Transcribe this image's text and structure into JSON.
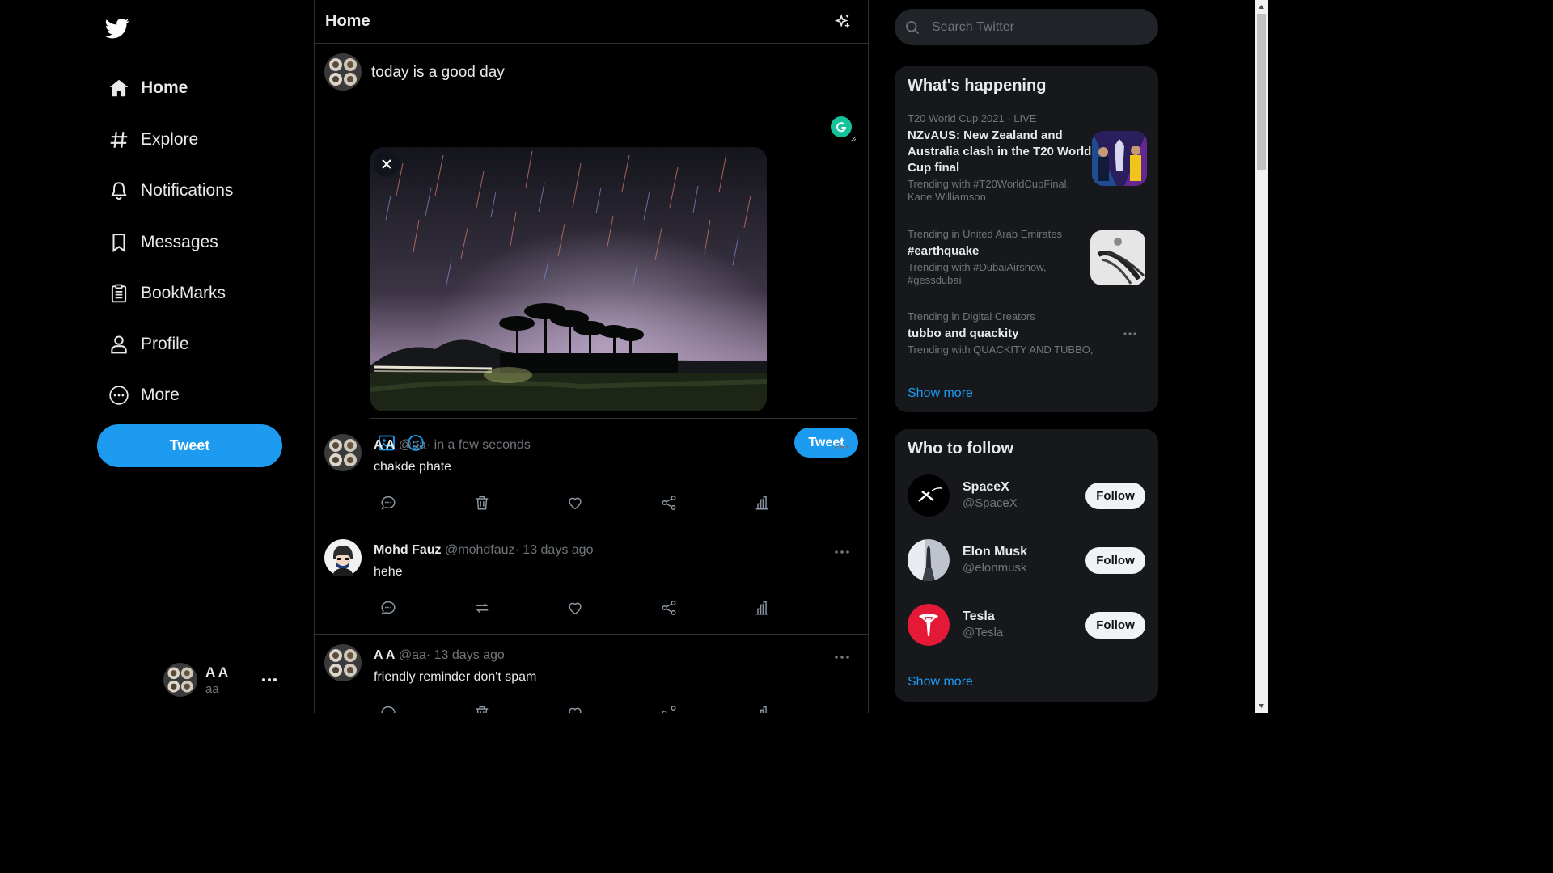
{
  "sidebar": {
    "nav": [
      {
        "label": "Home",
        "icon": "home-icon"
      },
      {
        "label": "Explore",
        "icon": "hashtag-icon"
      },
      {
        "label": "Notifications",
        "icon": "bell-icon"
      },
      {
        "label": "Messages",
        "icon": "bookmark-icon"
      },
      {
        "label": "BookMarks",
        "icon": "clipboard-icon"
      },
      {
        "label": "Profile",
        "icon": "user-icon"
      },
      {
        "label": "More",
        "icon": "more-circle-icon"
      }
    ],
    "tweet_button": "Tweet",
    "user": {
      "name": "A A",
      "handle": "aa"
    }
  },
  "main": {
    "title": "Home",
    "composer": {
      "text": "today is a good day",
      "tweet_button": "Tweet"
    },
    "tweets": [
      {
        "name": "A A",
        "handle": "@aa",
        "time": "· in a few seconds",
        "text": "chakde phate",
        "second_action_icon": "trash-icon"
      },
      {
        "name": "Mohd Fauz",
        "handle": "@mohdfauz",
        "time": "· 13 days ago",
        "text": "hehe",
        "second_action_icon": "retweet-icon"
      },
      {
        "name": "A A",
        "handle": "@aa",
        "time": "· 13 days ago",
        "text": "friendly reminder don't spam",
        "second_action_icon": "trash-icon"
      }
    ]
  },
  "right": {
    "search_placeholder": "Search Twitter",
    "happening": {
      "title": "What's happening",
      "trends": [
        {
          "meta": "T20 World Cup 2021 · LIVE",
          "title": "NZvAUS: New Zealand and Australia clash in the T20 World Cup final",
          "sub": "Trending with #T20WorldCupFinal, Kane Williamson"
        },
        {
          "meta": "Trending in United Arab Emirates",
          "title": "#earthquake",
          "sub": "Trending with #DubaiAirshow, #gessdubai"
        },
        {
          "meta": "Trending in Digital Creators",
          "title": "tubbo and quackity",
          "sub": "Trending with QUACKITY AND TUBBO,"
        }
      ],
      "show_more": "Show more"
    },
    "who_to_follow": {
      "title": "Who to follow",
      "accounts": [
        {
          "name": "SpaceX",
          "handle": "@SpaceX",
          "button": "Follow"
        },
        {
          "name": "Elon Musk",
          "handle": "@elonmusk",
          "button": "Follow"
        },
        {
          "name": "Tesla",
          "handle": "@Tesla",
          "button": "Follow"
        }
      ],
      "show_more": "Show more"
    }
  },
  "colors": {
    "accent": "#1d9bf0",
    "background": "#000000",
    "panel": "#16181c",
    "muted": "#71767b",
    "tesla_red": "#e31937"
  }
}
